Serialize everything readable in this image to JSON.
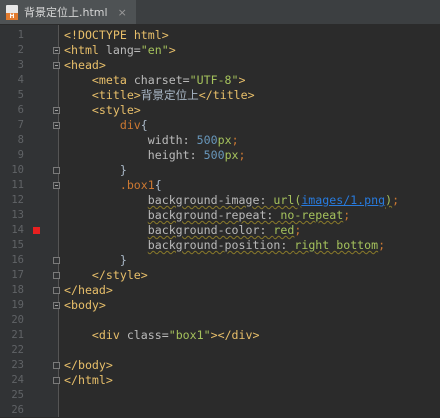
{
  "tab": {
    "filename": "背景定位上.html",
    "close": "×"
  },
  "lines": [
    {
      "n": "1",
      "tokens": [
        [
          "tag",
          "<!DOCTYPE "
        ],
        [
          "tag",
          "html"
        ],
        [
          "tag",
          ">"
        ]
      ]
    },
    {
      "n": "2",
      "tokens": [
        [
          "tag",
          "<html "
        ],
        [
          "attr",
          "lang="
        ],
        [
          "str",
          "\"en\""
        ],
        [
          "tag",
          ">"
        ]
      ]
    },
    {
      "n": "3",
      "tokens": [
        [
          "tag",
          "<head>"
        ]
      ]
    },
    {
      "n": "4",
      "tokens": [
        [
          "plain",
          "    "
        ],
        [
          "tag",
          "<meta "
        ],
        [
          "attr",
          "charset="
        ],
        [
          "str",
          "\"UTF-8\""
        ],
        [
          "tag",
          ">"
        ]
      ]
    },
    {
      "n": "5",
      "tokens": [
        [
          "plain",
          "    "
        ],
        [
          "tag",
          "<title>"
        ],
        [
          "plain",
          "背景定位上"
        ],
        [
          "tag",
          "</title>"
        ]
      ]
    },
    {
      "n": "6",
      "tokens": [
        [
          "plain",
          "    "
        ],
        [
          "tag",
          "<style>"
        ]
      ]
    },
    {
      "n": "7",
      "tokens": [
        [
          "plain",
          "        "
        ],
        [
          "sel",
          "div"
        ],
        [
          "plain",
          "{"
        ]
      ]
    },
    {
      "n": "8",
      "tokens": [
        [
          "plain",
          "            "
        ],
        [
          "prop",
          "width: "
        ],
        [
          "num",
          "500"
        ],
        [
          "val",
          "px"
        ],
        [
          "punc",
          ";"
        ]
      ]
    },
    {
      "n": "9",
      "tokens": [
        [
          "plain",
          "            "
        ],
        [
          "prop",
          "height: "
        ],
        [
          "num",
          "500"
        ],
        [
          "val",
          "px"
        ],
        [
          "punc",
          ";"
        ]
      ]
    },
    {
      "n": "10",
      "tokens": [
        [
          "plain",
          "        }"
        ]
      ]
    },
    {
      "n": "11",
      "tokens": [
        [
          "plain",
          "        "
        ],
        [
          "sel",
          ".box1"
        ],
        [
          "plain",
          "{"
        ]
      ]
    },
    {
      "n": "12",
      "tokens": [
        [
          "plain",
          "            "
        ],
        [
          "sprop",
          "background-image: "
        ],
        [
          "sval",
          "url("
        ],
        [
          "link",
          "images/1.png"
        ],
        [
          "sval",
          ")"
        ],
        [
          "punc",
          ";"
        ]
      ]
    },
    {
      "n": "13",
      "tokens": [
        [
          "plain",
          "            "
        ],
        [
          "sprop",
          "background-repeat: "
        ],
        [
          "sval",
          "no-repeat"
        ],
        [
          "punc",
          ";"
        ]
      ]
    },
    {
      "n": "14",
      "tokens": [
        [
          "plain",
          "            "
        ],
        [
          "sprop",
          "background-color: "
        ],
        [
          "sval",
          "red"
        ],
        [
          "punc",
          ";"
        ]
      ]
    },
    {
      "n": "15",
      "tokens": [
        [
          "plain",
          "            "
        ],
        [
          "sprop",
          "background-position: "
        ],
        [
          "sval",
          "right bottom"
        ],
        [
          "punc",
          ";"
        ]
      ]
    },
    {
      "n": "16",
      "tokens": [
        [
          "plain",
          "        }"
        ]
      ]
    },
    {
      "n": "17",
      "tokens": [
        [
          "plain",
          "    "
        ],
        [
          "tag",
          "</style>"
        ]
      ]
    },
    {
      "n": "18",
      "tokens": [
        [
          "tag",
          "</head>"
        ]
      ]
    },
    {
      "n": "19",
      "tokens": [
        [
          "tag",
          "<body>"
        ]
      ]
    },
    {
      "n": "20",
      "tokens": []
    },
    {
      "n": "21",
      "tokens": [
        [
          "plain",
          "    "
        ],
        [
          "tag",
          "<div "
        ],
        [
          "attr",
          "class="
        ],
        [
          "str",
          "\"box1\""
        ],
        [
          "tag",
          "></div>"
        ]
      ]
    },
    {
      "n": "22",
      "tokens": []
    },
    {
      "n": "23",
      "tokens": [
        [
          "tag",
          "</body>"
        ]
      ]
    },
    {
      "n": "24",
      "tokens": [
        [
          "tag",
          "</html>"
        ]
      ]
    },
    {
      "n": "25",
      "tokens": []
    },
    {
      "n": "26",
      "tokens": []
    }
  ],
  "folds": {
    "2": "open",
    "3": "open",
    "6": "open",
    "7": "open",
    "10": "close",
    "11": "open",
    "16": "close",
    "17": "close",
    "18": "close",
    "19": "open",
    "23": "close",
    "24": "close"
  },
  "breakpoint_line": "14",
  "colors": {
    "background": "#2b2b2b",
    "gutter": "#313335",
    "tag": "#e8bf6a",
    "string": "#a5c25c",
    "number": "#6897bb",
    "link": "#287bde",
    "breakpoint": "#e82020"
  }
}
